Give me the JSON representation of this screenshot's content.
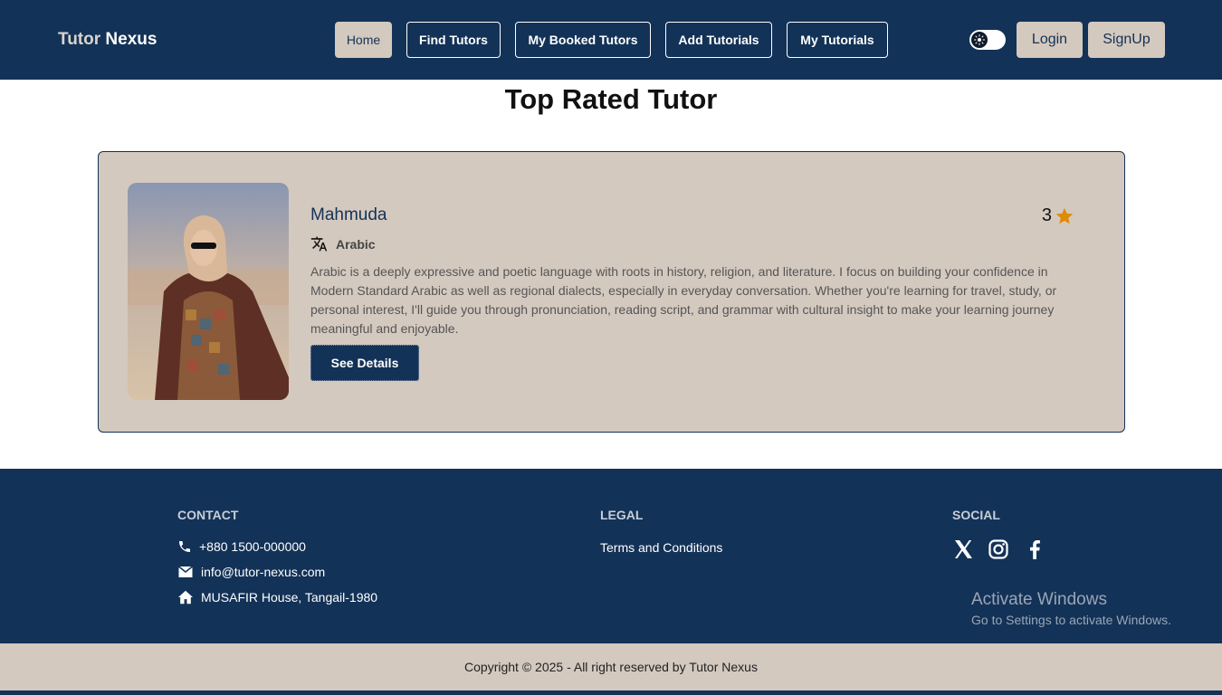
{
  "brand": {
    "part1": "Tutor",
    "part2": "Nexus"
  },
  "nav": {
    "home": "Home",
    "find_tutors": "Find Tutors",
    "my_booked_tutors": "My Booked Tutors",
    "add_tutorials": "Add Tutorials",
    "my_tutorials": "My Tutorials"
  },
  "auth": {
    "login": "Login",
    "signup": "SignUp"
  },
  "section": {
    "title": "Top Rated Tutor"
  },
  "tutor": {
    "name": "Mahmuda",
    "rating": "3",
    "language": "Arabic",
    "description": "Arabic is a deeply expressive and poetic language with roots in history, religion, and literature. I focus on building your confidence in Modern Standard Arabic as well as regional dialects, especially in everyday conversation. Whether you're learning for travel, study, or personal interest, I'll guide you through pronunciation, reading script, and grammar with cultural insight to make your learning journey meaningful and enjoyable.",
    "details_button": "See Details"
  },
  "footer": {
    "contact_title": "CONTACT",
    "phone": "+880 1500-000000",
    "email": "info@tutor-nexus.com",
    "address": "MUSAFIR House, Tangail-1980",
    "legal_title": "LEGAL",
    "terms": "Terms and Conditions",
    "social_title": "SOCIAL",
    "copyright": "Copyright © 2025 - All right reserved by Tutor Nexus"
  },
  "watermark": {
    "line1": "Activate Windows",
    "line2": "Go to Settings to activate Windows."
  },
  "colors": {
    "primary": "#133257",
    "beige": "#d4c9bf",
    "star": "#e08a00"
  },
  "icons": [
    "translate-icon",
    "star-icon",
    "phone-icon",
    "mail-icon",
    "home-icon",
    "x-twitter-icon",
    "instagram-icon",
    "facebook-icon",
    "sun-icon"
  ]
}
